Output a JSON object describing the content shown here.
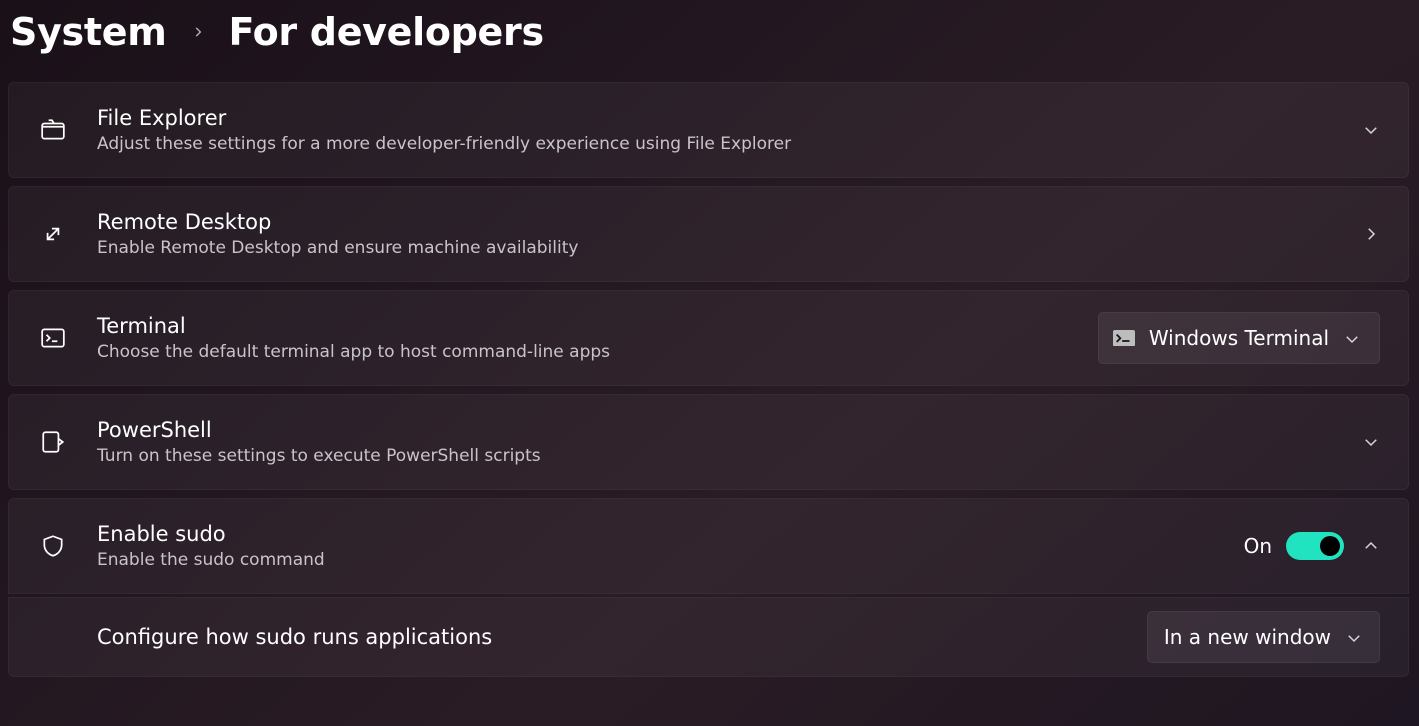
{
  "breadcrumb": {
    "parent": "System",
    "current": "For developers"
  },
  "cards": {
    "file_explorer": {
      "title": "File Explorer",
      "subtitle": "Adjust these settings for a more developer-friendly experience using File Explorer"
    },
    "remote_desktop": {
      "title": "Remote Desktop",
      "subtitle": "Enable Remote Desktop and ensure machine availability"
    },
    "terminal": {
      "title": "Terminal",
      "subtitle": "Choose the default terminal app to host command-line apps",
      "dropdown_value": "Windows Terminal"
    },
    "powershell": {
      "title": "PowerShell",
      "subtitle": "Turn on these settings to execute PowerShell scripts"
    },
    "sudo": {
      "title": "Enable sudo",
      "subtitle": "Enable the sudo command",
      "toggle_label": "On",
      "sub_title": "Configure how sudo runs applications",
      "sub_dropdown_value": "In a new window"
    }
  }
}
